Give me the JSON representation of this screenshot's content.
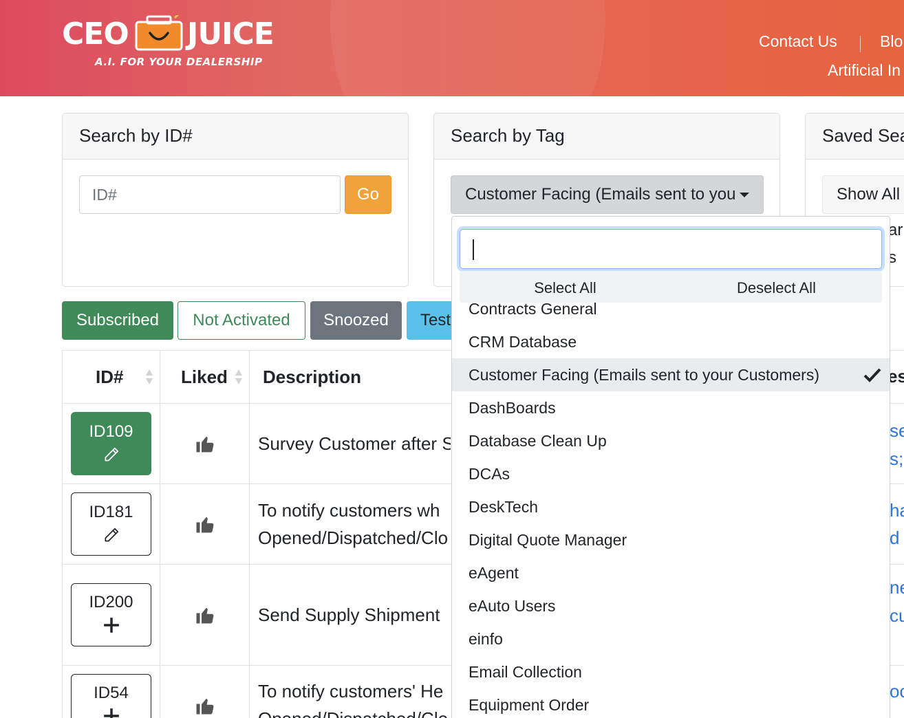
{
  "header": {
    "logo_left": "CEO",
    "logo_right": "JUICE",
    "logo_tagline": "A.I. FOR YOUR DEALERSHIP",
    "nav_contact": "Contact Us",
    "nav_blog": "Blo",
    "nav_ai": "Artificial In"
  },
  "search_id": {
    "title": "Search by ID#",
    "placeholder": "ID#",
    "go_label": "Go"
  },
  "search_tag": {
    "title": "Search by Tag",
    "selected": "Customer Facing (Emails sent to you"
  },
  "saved": {
    "title": "Saved Sea",
    "show_all": "Show All",
    "frag1": "ar",
    "frag2": "s"
  },
  "filters": {
    "subscribed": "Subscribed",
    "not_activated": "Not Activated",
    "snoozed": "Snoozed",
    "test": "Test"
  },
  "table": {
    "col_id": "ID#",
    "col_liked": "Liked",
    "col_desc": "Description",
    "col_right_frag": "ess",
    "rows": [
      {
        "id": "ID109",
        "desc1": "Survey Customer after S",
        "desc2": "",
        "r1": "se",
        "r2": "s; i"
      },
      {
        "id": "ID181",
        "desc1": "To notify customers wh",
        "desc2": "Opened/Dispatched/Clo",
        "r1": "ha",
        "r2": "d"
      },
      {
        "id": "ID200",
        "desc1": "Send Supply Shipment",
        "desc2": "",
        "r1": "ne",
        "r2": "cu"
      },
      {
        "id": "ID54",
        "desc1": "To notify customers' He",
        "desc2": "Opened/Dispatched/Clo",
        "r1": "oc",
        "r2": ""
      }
    ]
  },
  "dropdown": {
    "search_value": "",
    "select_all": "Select All",
    "deselect_all": "Deselect All",
    "items": [
      "Contracts General",
      "CRM Database",
      "Customer Facing (Emails sent to your Customers)",
      "DashBoards",
      "Database Clean Up",
      "DCAs",
      "DeskTech",
      "Digital Quote Manager",
      "eAgent",
      "eAuto Users",
      "einfo",
      "Email Collection",
      "Equipment Order"
    ],
    "selected_index": 2
  },
  "colors": {
    "green": "#3f8a58",
    "orange": "#f0a33a",
    "gray": "#6c757d",
    "info": "#5bc0e8",
    "link": "#2f74d9"
  }
}
